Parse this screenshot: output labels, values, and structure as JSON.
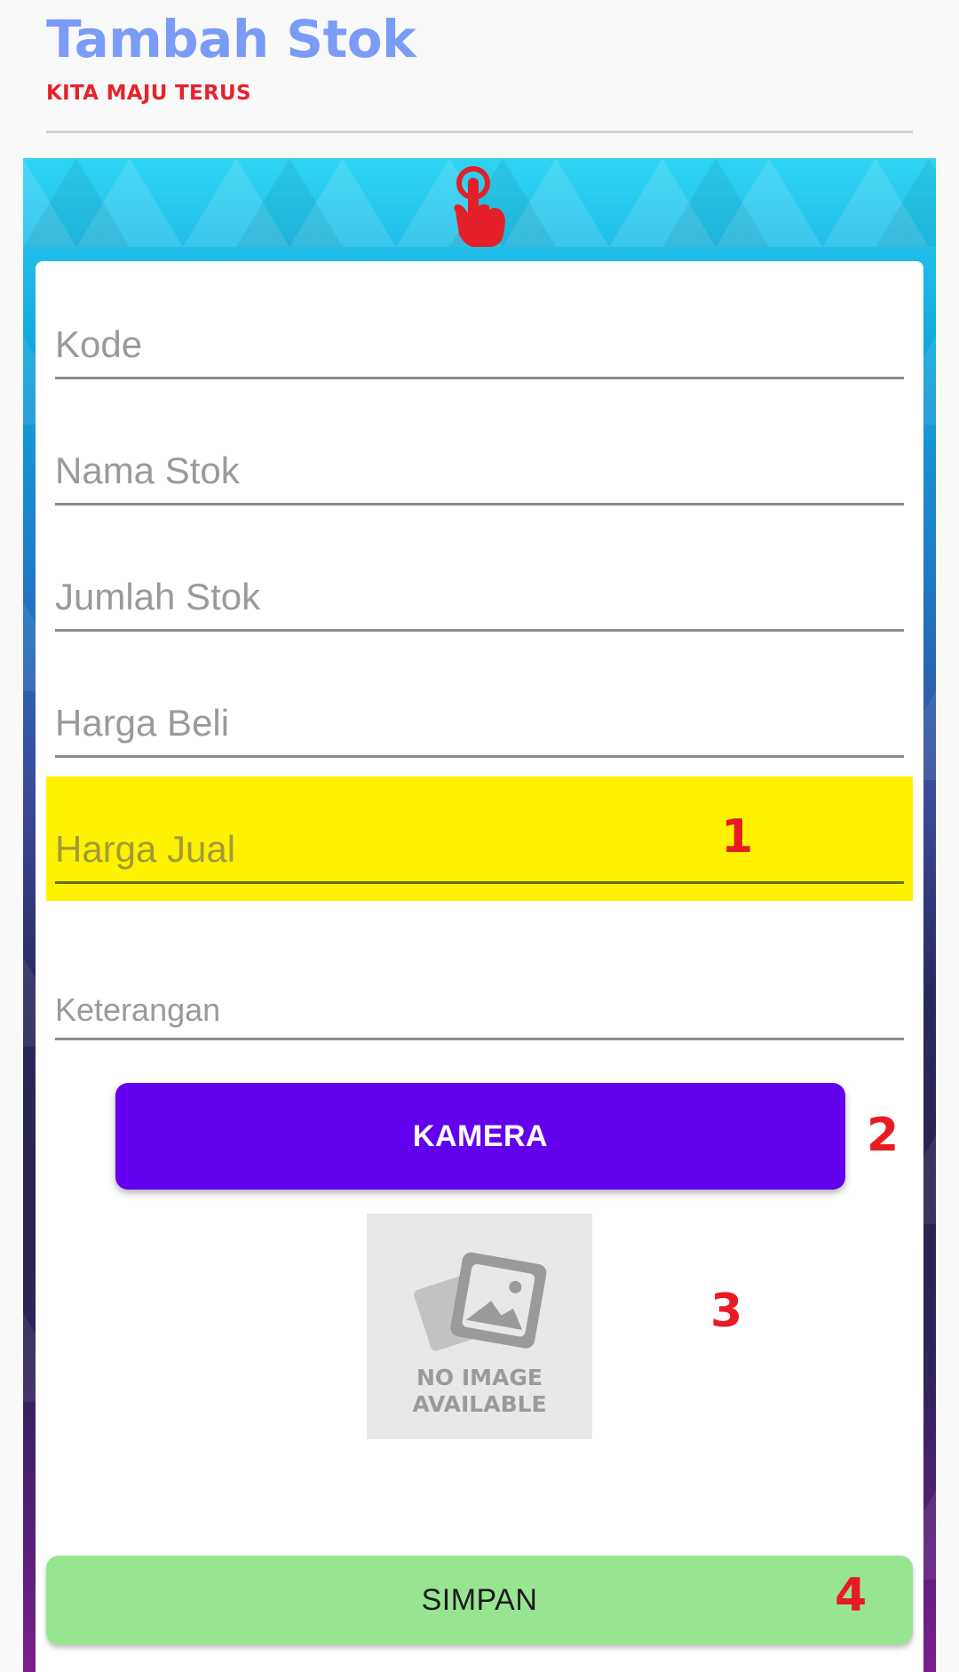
{
  "header": {
    "title": "Tambah Stok",
    "subtitle": "KITA MAJU TERUS"
  },
  "form": {
    "fields": [
      {
        "placeholder": "Kode"
      },
      {
        "placeholder": "Nama Stok"
      },
      {
        "placeholder": "Jumlah Stok"
      },
      {
        "placeholder": "Harga Beli"
      },
      {
        "placeholder": "Harga Jual"
      },
      {
        "placeholder": "Keterangan"
      }
    ],
    "kamera_label": "KAMERA",
    "image_placeholder": {
      "line1": "NO IMAGE",
      "line2": "AVAILABLE"
    },
    "simpan_label": "SIMPAN"
  },
  "annotations": [
    "1",
    "2",
    "3",
    "4"
  ],
  "icons": {
    "touch": "touch-hand-icon",
    "image": "image-placeholder-icon"
  },
  "colors": {
    "title": "#7b9cf6",
    "subtitle": "#e5232d",
    "kamera_button": "#6200ee",
    "simpan_button": "#98e591",
    "highlight": "#fff200",
    "annotation": "#e81b22"
  }
}
